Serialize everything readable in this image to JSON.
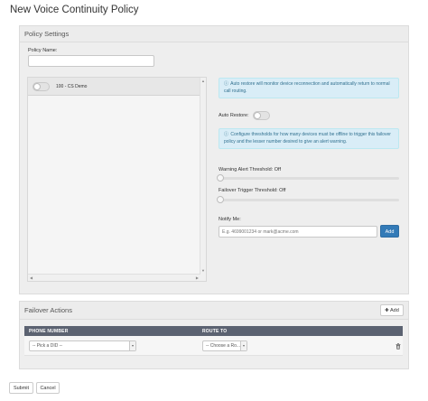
{
  "page": {
    "title": "New Voice Continuity Policy"
  },
  "policy_settings": {
    "title": "Policy Settings",
    "policy_name_label": "Policy Name:",
    "policy_name_value": "",
    "devices": [
      {
        "name": "100 - CS Demo",
        "enabled": false
      }
    ],
    "auto_restore_info": "Auto restore will monitor device reconnection and automatically return to normal call routing.",
    "auto_restore_label": "Auto Restore:",
    "auto_restore_enabled": false,
    "threshold_info": "Configure thresholds for how many devices must be offline to trigger this failover policy and the lesser number desired to give an alert warning.",
    "warning_alert_label": "Warning Alert Threshold:",
    "warning_alert_value": "Off",
    "failover_trigger_label": "Failover Trigger Threshold:",
    "failover_trigger_value": "Off",
    "notify_label": "Notify Me:",
    "notify_placeholder": "E.g. 4699001234 or mark@acme.com",
    "notify_add_label": "Add"
  },
  "failover_actions": {
    "title": "Failover Actions",
    "add_label": "Add",
    "columns": [
      "PHONE NUMBER",
      "ROUTE TO"
    ],
    "rows": [
      {
        "phone_number": "-- Pick a DID --",
        "route_to": "-- Choose a Ro..."
      }
    ]
  },
  "footer": {
    "submit_label": "Submit",
    "cancel_label": "Cancel"
  },
  "icons": {
    "info": "info-circle-icon",
    "add": "plus-icon",
    "delete": "trash-icon",
    "dropdown": "chevron-down-icon"
  },
  "colors": {
    "primary": "#337ab7",
    "info_bg": "#d9edf7",
    "info_text": "#31708f",
    "table_header": "#5b6271",
    "panel_bg": "#eeeeee"
  }
}
